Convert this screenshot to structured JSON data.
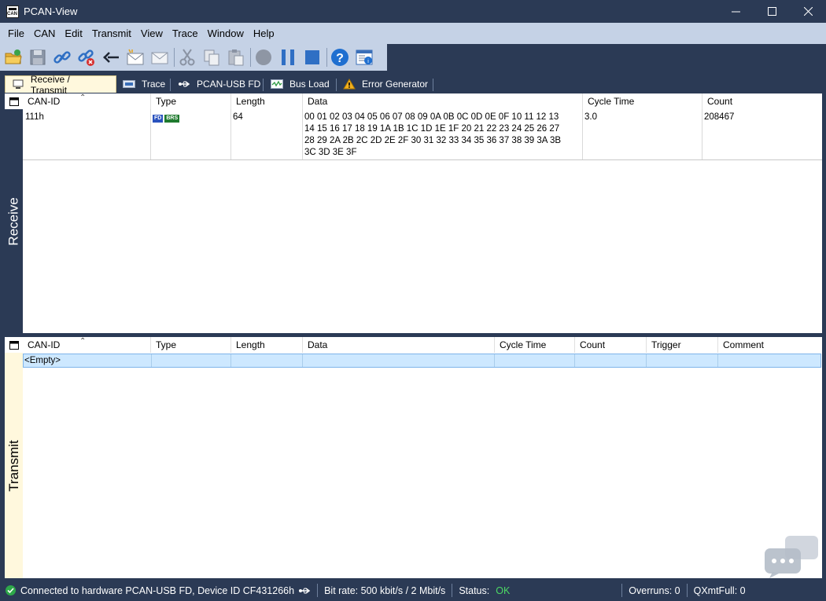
{
  "window": {
    "title": "PCAN-View",
    "controls": [
      "minimize-icon",
      "maximize-icon",
      "close-icon"
    ]
  },
  "menu": [
    "File",
    "CAN",
    "Edit",
    "Transmit",
    "View",
    "Trace",
    "Window",
    "Help"
  ],
  "toolbar": {
    "icons": [
      "open-folder-icon",
      "save-icon",
      "connect-icon",
      "disconnect-icon",
      "reset-icon",
      "new-message-icon",
      "edit-message-icon",
      "cut-icon",
      "copy-icon",
      "paste-icon",
      "record-icon",
      "pause-icon",
      "stop-icon",
      "help-icon",
      "properties-icon"
    ]
  },
  "tabs": [
    {
      "label": "Receive / Transmit",
      "icon": "monitor-icon",
      "active": true
    },
    {
      "label": "Trace",
      "icon": "trace-icon"
    },
    {
      "label": "PCAN-USB FD",
      "icon": "usb-icon"
    },
    {
      "label": "Bus Load",
      "icon": "bus-load-icon"
    },
    {
      "label": "Error Generator",
      "icon": "warning-icon"
    }
  ],
  "receive": {
    "side_label": "Receive",
    "columns": [
      "CAN-ID",
      "Type",
      "Length",
      "Data",
      "Cycle Time",
      "Count"
    ],
    "rows": [
      {
        "can_id": "111h",
        "type_badges": [
          "FD",
          "BRS"
        ],
        "length": "64",
        "data_lines": [
          "00 01 02 03 04 05 06 07 08 09 0A 0B 0C 0D 0E 0F 10 11 12 13",
          "14 15 16 17 18 19 1A 1B 1C 1D 1E 1F 20 21 22 23 24 25 26 27",
          "28 29 2A 2B 2C 2D 2E 2F 30 31 32 33 34 35 36 37 38 39 3A 3B",
          "3C 3D 3E 3F"
        ],
        "cycle_time": "3.0",
        "count": "208467"
      }
    ]
  },
  "transmit": {
    "side_label": "Transmit",
    "columns": [
      "CAN-ID",
      "Type",
      "Length",
      "Data",
      "Cycle Time",
      "Count",
      "Trigger",
      "Comment"
    ],
    "empty_text": "<Empty>"
  },
  "status": {
    "connection": "Connected to hardware PCAN-USB FD, Device ID CF431266h",
    "bitrate": "Bit rate: 500 kbit/s / 2 Mbit/s",
    "status_label": "Status:",
    "status_value": "OK",
    "overruns": "Overruns: 0",
    "qxmtfull": "QXmtFull: 0"
  },
  "colors": {
    "frame": "#2b3a55",
    "menu_bg": "#c5d2e6",
    "active_tab": "#fff8dd",
    "selection": "#cde8ff",
    "status_ok": "#4cd964"
  }
}
